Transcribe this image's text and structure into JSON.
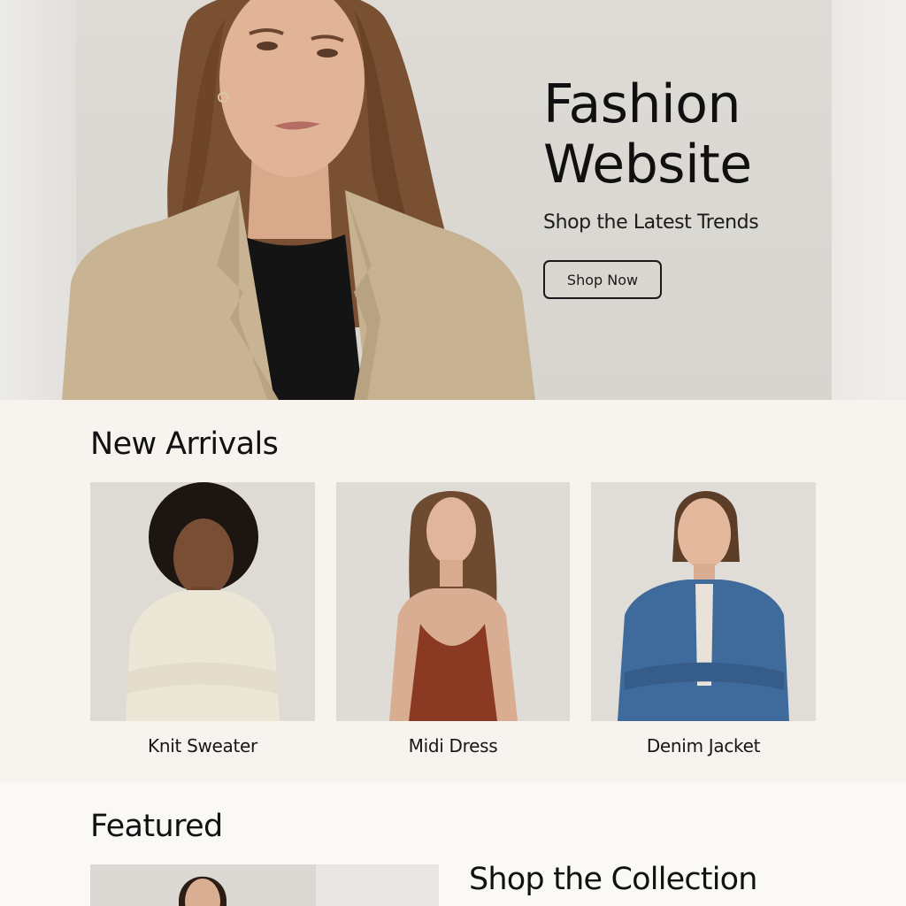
{
  "hero": {
    "title_line1": "Fashion",
    "title_line2": "Website",
    "subtitle": "Shop the Latest Trends",
    "cta_label": "Shop Now"
  },
  "new_arrivals": {
    "title": "New Arrivals",
    "products": [
      {
        "name": "Knit Sweater"
      },
      {
        "name": "Midi Dress"
      },
      {
        "name": "Denim Jacket"
      }
    ]
  },
  "featured": {
    "title": "Featured",
    "collection_heading": "Shop the Collection"
  },
  "colors": {
    "background": "#f7f4ef",
    "hero_panel": "#dbd8d3",
    "text": "#141414",
    "blazer": "#c9b596",
    "sweater": "#ece6d7",
    "dress": "#8a3a22",
    "denim": "#3f6a9c"
  }
}
